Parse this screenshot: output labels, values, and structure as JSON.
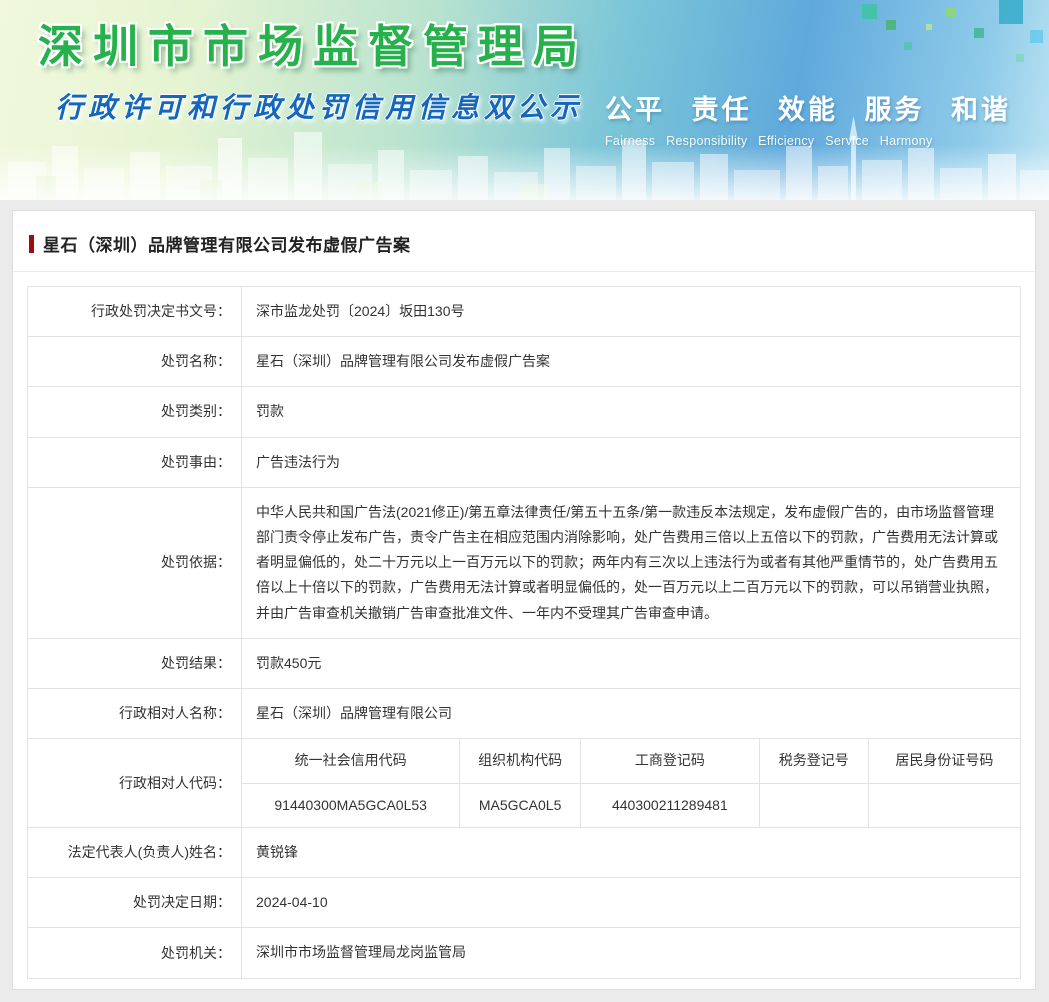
{
  "banner": {
    "title": "深圳市市场监督管理局",
    "subtitle": "行政许可和行政处罚信用信息双公示",
    "slogan_cn": "公平 责任 效能 服务 和谐",
    "slogan_en": "Fairness Responsibility Efficiency Service Harmony"
  },
  "colors": {
    "banner_title_green": "#27b14c",
    "subtitle_blue": "#1566bd",
    "title_marker_red": "#9e0e10"
  },
  "page": {
    "title": "星石（深圳）品牌管理有限公司发布虚假广告案"
  },
  "record": {
    "rows": [
      {
        "label": "行政处罚决定书文号：",
        "value": "深市监龙处罚〔2024〕坂田130号"
      },
      {
        "label": "处罚名称：",
        "value": "星石（深圳）品牌管理有限公司发布虚假广告案"
      },
      {
        "label": "处罚类别：",
        "value": "罚款"
      },
      {
        "label": "处罚事由：",
        "value": "广告违法行为"
      },
      {
        "label": "处罚依据：",
        "value": "中华人民共和国广告法(2021修正)/第五章法律责任/第五十五条/第一款违反本法规定，发布虚假广告的，由市场监督管理部门责令停止发布广告，责令广告主在相应范围内消除影响，处广告费用三倍以上五倍以下的罚款，广告费用无法计算或者明显偏低的，处二十万元以上一百万元以下的罚款；两年内有三次以上违法行为或者有其他严重情节的，处广告费用五倍以上十倍以下的罚款，广告费用无法计算或者明显偏低的，处一百万元以上二百万元以下的罚款，可以吊销营业执照，并由广告审查机关撤销广告审查批准文件、一年内不受理其广告审查申请。"
      },
      {
        "label": "处罚结果：",
        "value": "罚款450元"
      },
      {
        "label": "行政相对人名称：",
        "value": "星石（深圳）品牌管理有限公司"
      }
    ],
    "codes": {
      "label": "行政相对人代码：",
      "headers": [
        "统一社会信用代码",
        "组织机构代码",
        "工商登记码",
        "税务登记号",
        "居民身份证号码"
      ],
      "values": [
        "91440300MA5GCA0L53",
        "MA5GCA0L5",
        "440300211289481",
        "",
        ""
      ]
    },
    "rows2": [
      {
        "label": "法定代表人(负责人)姓名：",
        "value": "黄锐锋"
      },
      {
        "label": "处罚决定日期：",
        "value": "2024-04-10"
      },
      {
        "label": "处罚机关：",
        "value": "深圳市市场监督管理局龙岗监管局"
      }
    ]
  }
}
